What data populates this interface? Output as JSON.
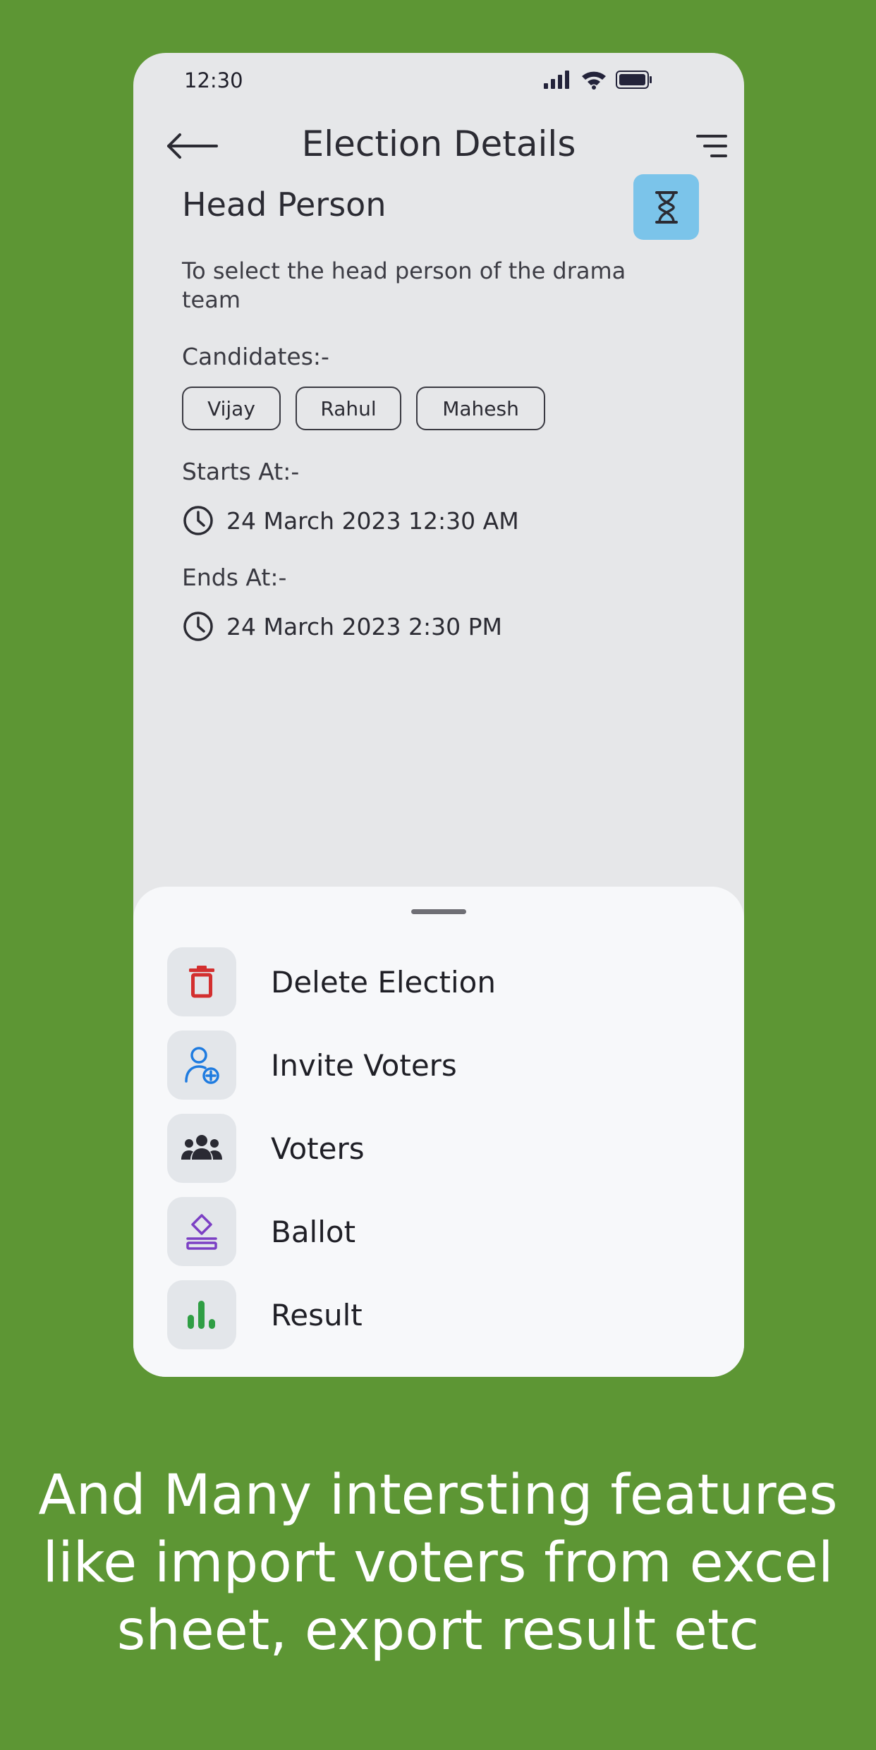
{
  "status_bar": {
    "time": "12:30",
    "icons": [
      "signal-icon",
      "wifi-icon",
      "battery-icon"
    ]
  },
  "header": {
    "title": "Election Details",
    "back_icon": "arrow-left-icon",
    "menu_icon": "menu-icon"
  },
  "election": {
    "name": "Head Person",
    "status_icon": "hourglass-icon",
    "status_color": "#7bc4ea",
    "description": "To select the head person of the drama team",
    "candidates_label": "Candidates:-",
    "candidates": [
      "Vijay",
      "Rahul",
      "Mahesh"
    ],
    "starts_label": "Starts At:-",
    "starts_at": "24 March 2023 12:30 AM",
    "ends_label": "Ends At:-",
    "ends_at": "24 March 2023 2:30 PM"
  },
  "sheet": {
    "items": [
      {
        "label": "Delete Election",
        "icon": "trash-icon",
        "color": "#d32f2f"
      },
      {
        "label": "Invite Voters",
        "icon": "add-user-icon",
        "color": "#1e7be0"
      },
      {
        "label": "Voters",
        "icon": "group-icon",
        "color": "#2a2a33"
      },
      {
        "label": "Ballot",
        "icon": "ballot-icon",
        "color": "#7b3fc4"
      },
      {
        "label": "Result",
        "icon": "bar-chart-icon",
        "color": "#2f9e44"
      }
    ]
  },
  "caption": {
    "line1": "And Many intersting features",
    "line2": "like import voters from excel",
    "line3": "sheet, export result etc"
  },
  "colors": {
    "background": "#5d9634",
    "phone": "#e6e7e9",
    "sheet": "#f7f8fa"
  }
}
